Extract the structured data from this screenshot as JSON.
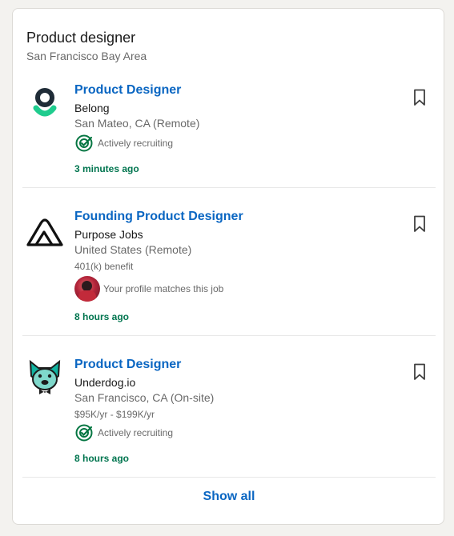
{
  "header": {
    "title": "Product designer",
    "subtitle": "San Francisco Bay Area"
  },
  "jobs": [
    {
      "title": "Product Designer",
      "company": "Belong",
      "location": "San Mateo, CA (Remote)",
      "insight": "Actively recruiting",
      "time": "3 minutes ago",
      "logo_icon": "belong-logo-icon"
    },
    {
      "title": "Founding Product Designer",
      "company": "Purpose Jobs",
      "location": "United States (Remote)",
      "benefit": "401(k) benefit",
      "insight": "Your profile matches this job",
      "time": "8 hours ago",
      "logo_icon": "purpose-jobs-logo-icon"
    },
    {
      "title": "Product Designer",
      "company": "Underdog.io",
      "location": "San Francisco, CA (On-site)",
      "salary": "$95K/yr - $199K/yr",
      "insight": "Actively recruiting",
      "time": "8 hours ago",
      "logo_icon": "underdog-logo-icon"
    }
  ],
  "footer": {
    "show_all": "Show all"
  },
  "colors": {
    "link": "#0a66c2",
    "time_green": "#01754f",
    "icon_green": "#057642",
    "background": "#f3f2ef"
  }
}
